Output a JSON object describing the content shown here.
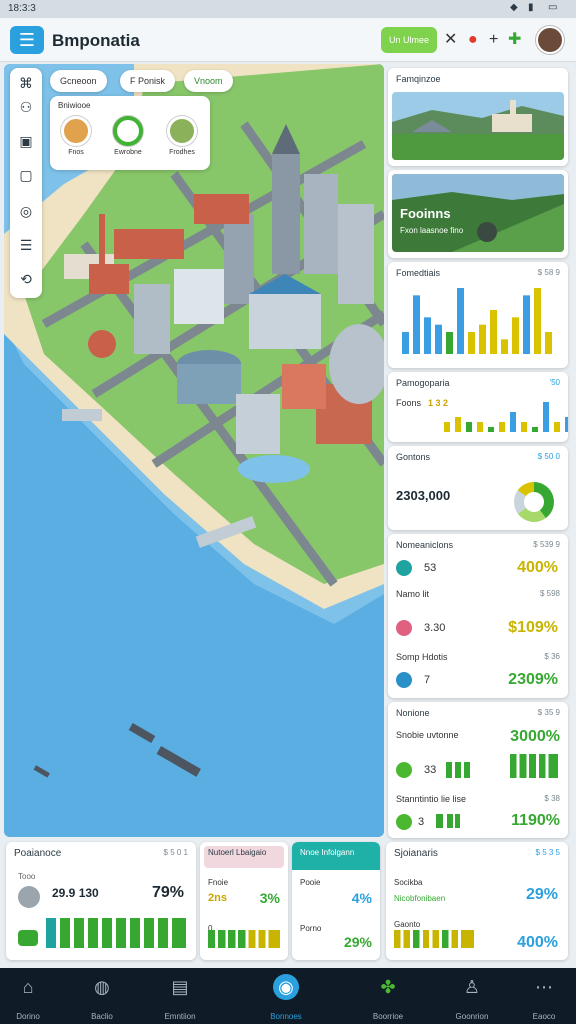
{
  "status_bar": {
    "time": "18:3:3"
  },
  "header": {
    "title": "Bmponatia",
    "pill_label": "Un Ulmee"
  },
  "map": {
    "filter_chips": [
      "Gcneoon",
      "F Ponisk",
      "Vnoom"
    ],
    "layers": {
      "title": "Bniwiooe",
      "items": [
        "Fnos",
        "Ewrobne",
        "Frodhes"
      ]
    }
  },
  "side_cards": {
    "card1": {
      "title": "Famqinzoe"
    },
    "card2": {
      "photo_title": "Fooinns",
      "photo_sub": "Fxon laasnoe fino"
    },
    "card3": {
      "title": "Fomedtiais",
      "value": "$ 58 9"
    },
    "card4": {
      "title": "Pamogoparia",
      "value": "'50",
      "label": "Foons",
      "number": "1 3 2"
    },
    "card5": {
      "title": "Gontons",
      "value": "$ 50 0",
      "amount": "2303,000"
    },
    "card6": {
      "title": "Nomeaniclons",
      "value": "$ 539 9",
      "rows": [
        {
          "label": "",
          "num": "53",
          "pct": "400%",
          "pval": ""
        },
        {
          "label": "Namo lit",
          "num": "3.30",
          "pct": "$109%",
          "pval": "$ 598"
        },
        {
          "label": "Somp Hdotis",
          "num": "7",
          "pct": "2309%",
          "pval": "$ 36"
        }
      ]
    },
    "card7": {
      "title": "Nonione",
      "value": "$ 35 9",
      "rows": [
        {
          "label": "Snobie uvtonne",
          "num": "33",
          "pct": "3000%"
        },
        {
          "label": "Stanntintio lie lise",
          "num": "3",
          "pct": "1190%",
          "pval": "$ 38"
        }
      ]
    }
  },
  "bottom_cards": {
    "c1": {
      "title": "Poaianoce",
      "value": "$ 5 0 1",
      "sub": "Tooo",
      "amount": "29.9 130",
      "pct": "79%"
    },
    "c2": {
      "title": "Nutoerl Lbaigaio",
      "label": "Fnoie",
      "num": "2ns",
      "pct": "3%",
      "label2": "0"
    },
    "c3": {
      "title": "Nnoe Infolgann",
      "label": "Pooie",
      "num": "4%",
      "label2": "Porno",
      "num2": "29%"
    },
    "c4": {
      "title": "Sjoianaris",
      "value": "$ 5 3 5",
      "label": "Socikba",
      "sub": "Nicobfonibaen",
      "pct": "29%",
      "label2": "Gaonto",
      "pct2": "400%"
    }
  },
  "nav": [
    "Dorino",
    "Baclio",
    "Emntiion",
    "Bonnoes",
    "Boorrioe",
    "Goonrion",
    "Eaoco"
  ],
  "chart_data": [
    {
      "type": "bar",
      "title": "Fomedtiais",
      "values": [
        3,
        8,
        5,
        4,
        3,
        9,
        3,
        4,
        6,
        2,
        5,
        8,
        9,
        3
      ]
    },
    {
      "type": "bar",
      "title": "Pamogoparia",
      "values": [
        2,
        3,
        2,
        2,
        1,
        2,
        4,
        2,
        1,
        6,
        2,
        3
      ]
    },
    {
      "type": "pie",
      "title": "Gontons",
      "values": [
        40,
        25,
        20,
        15
      ]
    }
  ],
  "colors": {
    "accent": "#2aa0df",
    "green": "#36a832",
    "yellow": "#d9c200",
    "bar_blue": "#3b9ee3"
  }
}
